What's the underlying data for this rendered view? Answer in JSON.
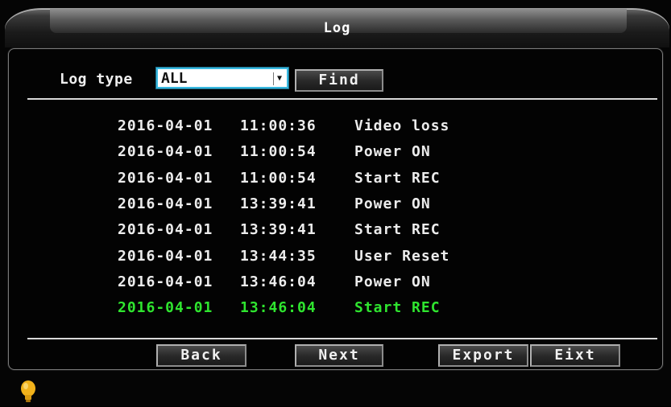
{
  "window": {
    "title": "Log"
  },
  "filter": {
    "label": "Log type",
    "selected": "ALL",
    "find_label": "Find"
  },
  "log_entries": [
    {
      "date": "2016-04-01",
      "time": "11:00:36",
      "event": "Video loss",
      "selected": false
    },
    {
      "date": "2016-04-01",
      "time": "11:00:54",
      "event": "Power ON",
      "selected": false
    },
    {
      "date": "2016-04-01",
      "time": "11:00:54",
      "event": "Start REC",
      "selected": false
    },
    {
      "date": "2016-04-01",
      "time": "13:39:41",
      "event": "Power ON",
      "selected": false
    },
    {
      "date": "2016-04-01",
      "time": "13:39:41",
      "event": "Start REC",
      "selected": false
    },
    {
      "date": "2016-04-01",
      "time": "13:44:35",
      "event": "User Reset",
      "selected": false
    },
    {
      "date": "2016-04-01",
      "time": "13:46:04",
      "event": "Power ON",
      "selected": false
    },
    {
      "date": "2016-04-01",
      "time": "13:46:04",
      "event": "Start REC",
      "selected": true
    }
  ],
  "footer": {
    "back_label": "Back",
    "next_label": "Next",
    "export_label": "Export",
    "exit_label": "Eixt"
  },
  "status": {
    "indicator_icon": "lightbulb-icon"
  },
  "colors": {
    "selected_row": "#2fe52f",
    "focus_border": "#38b8e0",
    "bulb": "#f2b21b"
  }
}
